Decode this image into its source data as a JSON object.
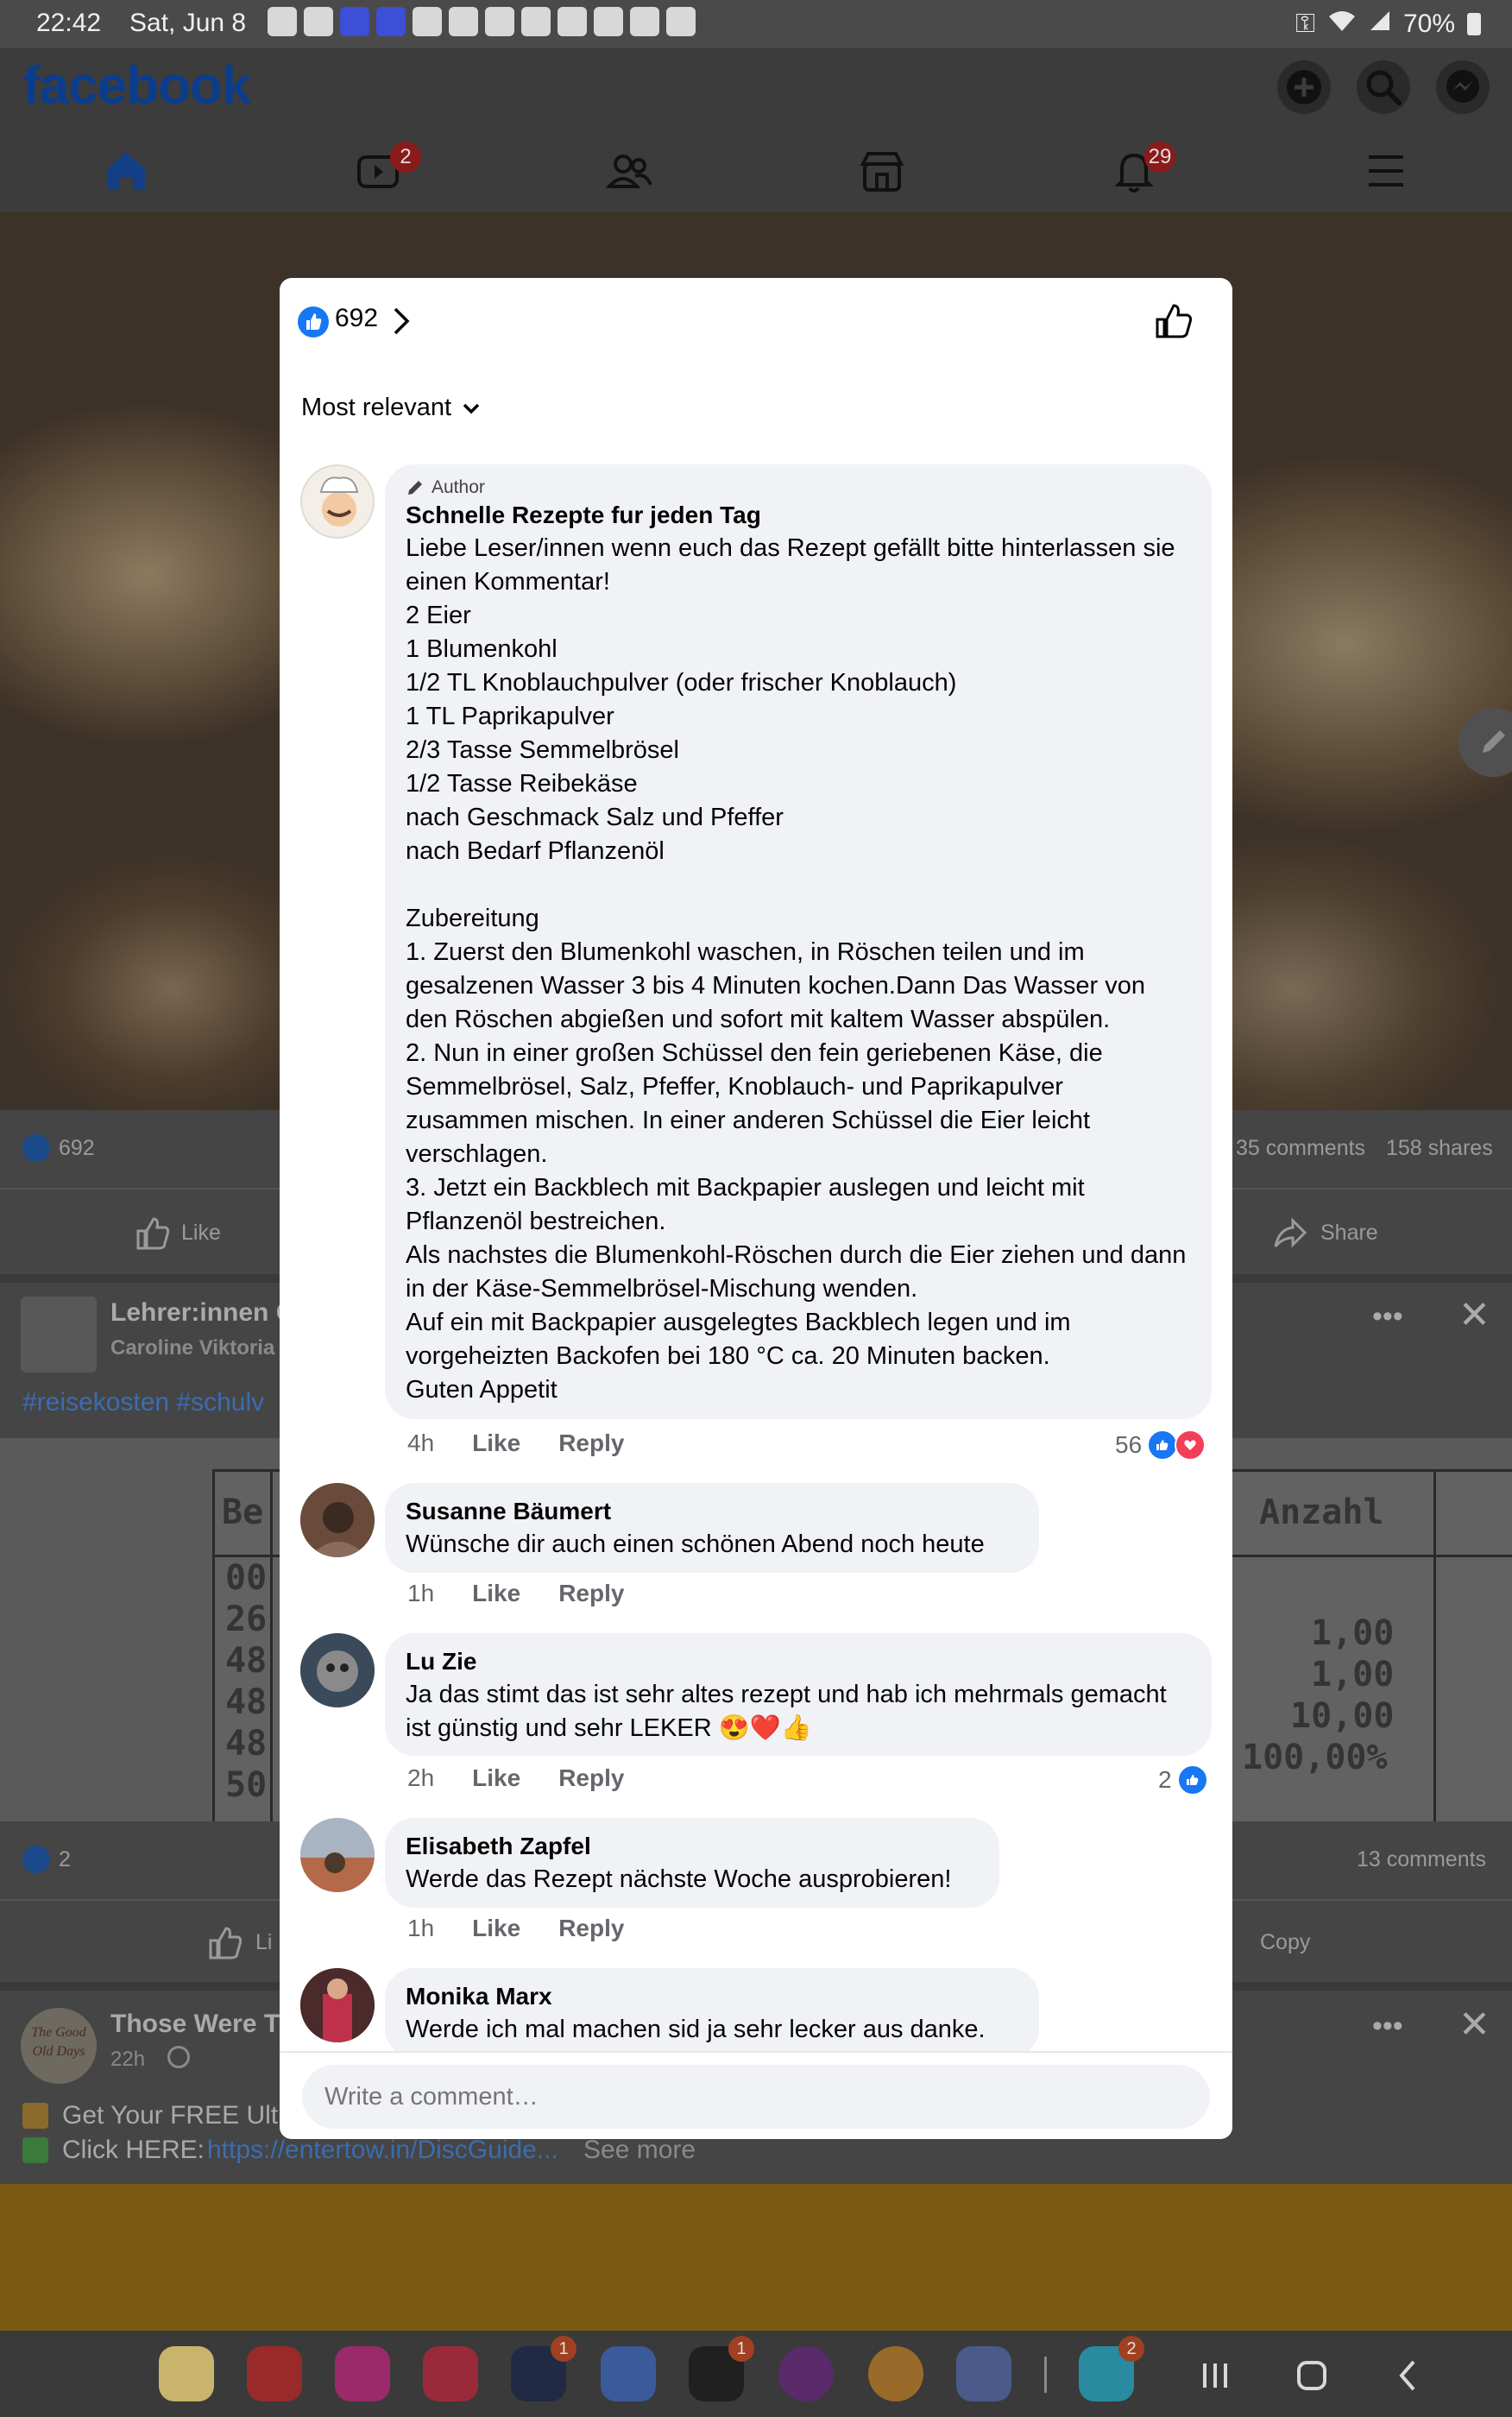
{
  "status_bar": {
    "time": "22:42",
    "date": "Sat, Jun 8",
    "battery": "70%"
  },
  "header": {
    "logo": "facebook",
    "icons": [
      "plus-icon",
      "search-icon",
      "messenger-icon"
    ],
    "nav": [
      {
        "name": "home-icon",
        "badge": ""
      },
      {
        "name": "video-icon",
        "badge": "2"
      },
      {
        "name": "friends-icon",
        "badge": ""
      },
      {
        "name": "marketplace-icon",
        "badge": ""
      },
      {
        "name": "bell-icon",
        "badge": "29"
      },
      {
        "name": "menu-icon",
        "badge": ""
      }
    ]
  },
  "feed": {
    "post1": {
      "reactions": "692",
      "comments": "35 comments",
      "shares": "158 shares",
      "like_label": "Like",
      "share_label": "Share"
    },
    "post2": {
      "page_name": "Lehrer:innen Ö",
      "author": "Caroline Viktoria",
      "hashtags": "#reisekosten #schulv",
      "table_header_left": "Be",
      "table_header_right": "Anzahl",
      "table_left_values": [
        "00",
        "26",
        "48",
        "48",
        "48",
        "50"
      ],
      "table_right_values": [
        "1,00",
        "1,00",
        "10,00",
        "100,00%"
      ],
      "reactions": "2",
      "comments": "13 comments",
      "like_label": "Li",
      "copy_label": "Copy"
    },
    "post3": {
      "page_name": "Those Were T",
      "time": "22h",
      "logo_text": "The Good Old Days",
      "line1": "Get Your FREE Ulti",
      "line2_prefix": "Click HERE: ",
      "line2_link": "https://entertow.in/DiscGuide...",
      "see_more": "See more"
    }
  },
  "modal": {
    "like_count": "692",
    "sort_label": "Most relevant",
    "comments": [
      {
        "author_tag": "Author",
        "name": "Schnelle Rezepte fur jeden Tag",
        "text": "Liebe Leser/innen wenn euch das Rezept gefällt bitte hinterlassen sie einen Kommentar!\n2 Eier\n1 Blumenkohl\n1/2 TL Knoblauchpulver (oder frischer Knoblauch)\n1 TL Paprikapulver\n2/3 Tasse Semmelbrösel\n1/2 Tasse Reibekäse\nnach Geschmack Salz und Pfeffer\nnach Bedarf Pflanzenöl\n\nZubereitung\n1. Zuerst den Blumenkohl waschen, in Röschen teilen und im gesalzenen Wasser 3 bis 4 Minuten kochen.Dann Das Wasser von den Röschen abgießen und sofort mit kaltem Wasser abspülen.\n2. Nun in einer großen Schüssel den fein geriebenen Käse, die Semmelbrösel, Salz, Pfeffer, Knoblauch- und Paprikapulver zusammen mischen. In einer anderen Schüssel die Eier leicht verschlagen.\n3. Jetzt ein Backblech mit Backpapier auslegen und leicht mit Pflanzenöl bestreichen.\nAls nachstes die Blumenkohl-Röschen durch die Eier ziehen und dann in der Käse-Semmelbrösel-Mischung wenden.\nAuf ein mit Backpapier ausgelegtes Backblech legen und im vorgeheizten Backofen bei 180 °C ca. 20 Minuten backen.\nGuten Appetit",
        "time": "4h",
        "like": "Like",
        "reply": "Reply",
        "reactions": "56"
      },
      {
        "name": "Susanne Bäumert",
        "text": "Wünsche dir auch einen schönen Abend noch heute",
        "time": "1h",
        "like": "Like",
        "reply": "Reply"
      },
      {
        "name": "Lu Zie",
        "text": "Ja das stimt das ist sehr altes rezept und hab ich mehrmals gemacht ist günstig und sehr LEKER 😍❤️👍",
        "time": "2h",
        "like": "Like",
        "reply": "Reply",
        "reactions": "2"
      },
      {
        "name": "Elisabeth Zapfel",
        "text": "Werde das Rezept nächste Woche ausprobieren!",
        "time": "1h",
        "like": "Like",
        "reply": "Reply"
      },
      {
        "name": "Monika Marx",
        "text": "Werde ich mal machen sid ja sehr lecker aus danke."
      }
    ],
    "comment_placeholder": "Write a comment…"
  },
  "dock": {
    "apps": [
      "notes-app-icon",
      "flipboard-app-icon",
      "flower-app-icon",
      "camera-app-icon",
      "hexagon-app-icon",
      "translate-app-icon",
      "apps-grid-icon",
      "firefox-app-icon",
      "chrome-app-icon",
      "app-drawer-icon",
      "mail-app-icon"
    ],
    "badges": {
      "hexagon-app-icon": "1",
      "apps-grid-icon": "1",
      "mail-app-icon": "2"
    }
  },
  "colors": {
    "facebook_blue": "#1877f2",
    "badge_red": "#e41e3f",
    "bubble_bg": "#f0f2f5",
    "meta_gray": "#65676b"
  }
}
